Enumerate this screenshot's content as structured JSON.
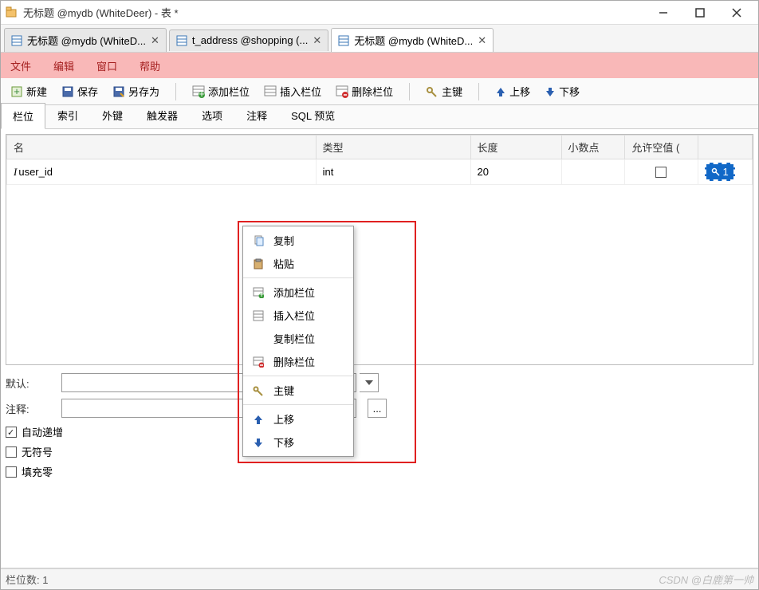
{
  "window": {
    "title": "无标题 @mydb (WhiteDeer) - 表 *"
  },
  "tabs": [
    {
      "label": "无标题 @mydb (WhiteD...",
      "active": false
    },
    {
      "label": "t_address @shopping (...",
      "active": false
    },
    {
      "label": "无标题 @mydb (WhiteD...",
      "active": true
    }
  ],
  "menu": {
    "file": "文件",
    "edit": "编辑",
    "window": "窗口",
    "help": "帮助"
  },
  "toolbar": {
    "new": "新建",
    "save": "保存",
    "saveas": "另存为",
    "addfield": "添加栏位",
    "insertfield": "插入栏位",
    "deletefield": "删除栏位",
    "primarykey": "主键",
    "moveup": "上移",
    "movedown": "下移"
  },
  "subtabs": {
    "fields": "栏位",
    "indexes": "索引",
    "foreignkeys": "外键",
    "triggers": "触发器",
    "options": "选项",
    "comment": "注释",
    "sqlpreview": "SQL 预览"
  },
  "columns": {
    "name": "名",
    "type": "类型",
    "length": "长度",
    "decimals": "小数点",
    "allownull": "允许空值 ("
  },
  "row": {
    "name": "user_id",
    "type": "int",
    "length": "20",
    "decimals": "",
    "keynum": "1"
  },
  "form": {
    "default_label": "默认:",
    "comment_label": "注释:",
    "autoinc": "自动递增",
    "unsigned": "无符号",
    "zerofill": "填充零"
  },
  "context": {
    "copy": "复制",
    "paste": "粘贴",
    "addfield": "添加栏位",
    "insertfield": "插入栏位",
    "dupfield": "复制栏位",
    "delfield": "删除栏位",
    "primarykey": "主键",
    "moveup": "上移",
    "movedown": "下移"
  },
  "status": {
    "fieldcount_label": "栏位数:",
    "fieldcount": "1",
    "watermark": "CSDN @白鹿第一帅"
  }
}
